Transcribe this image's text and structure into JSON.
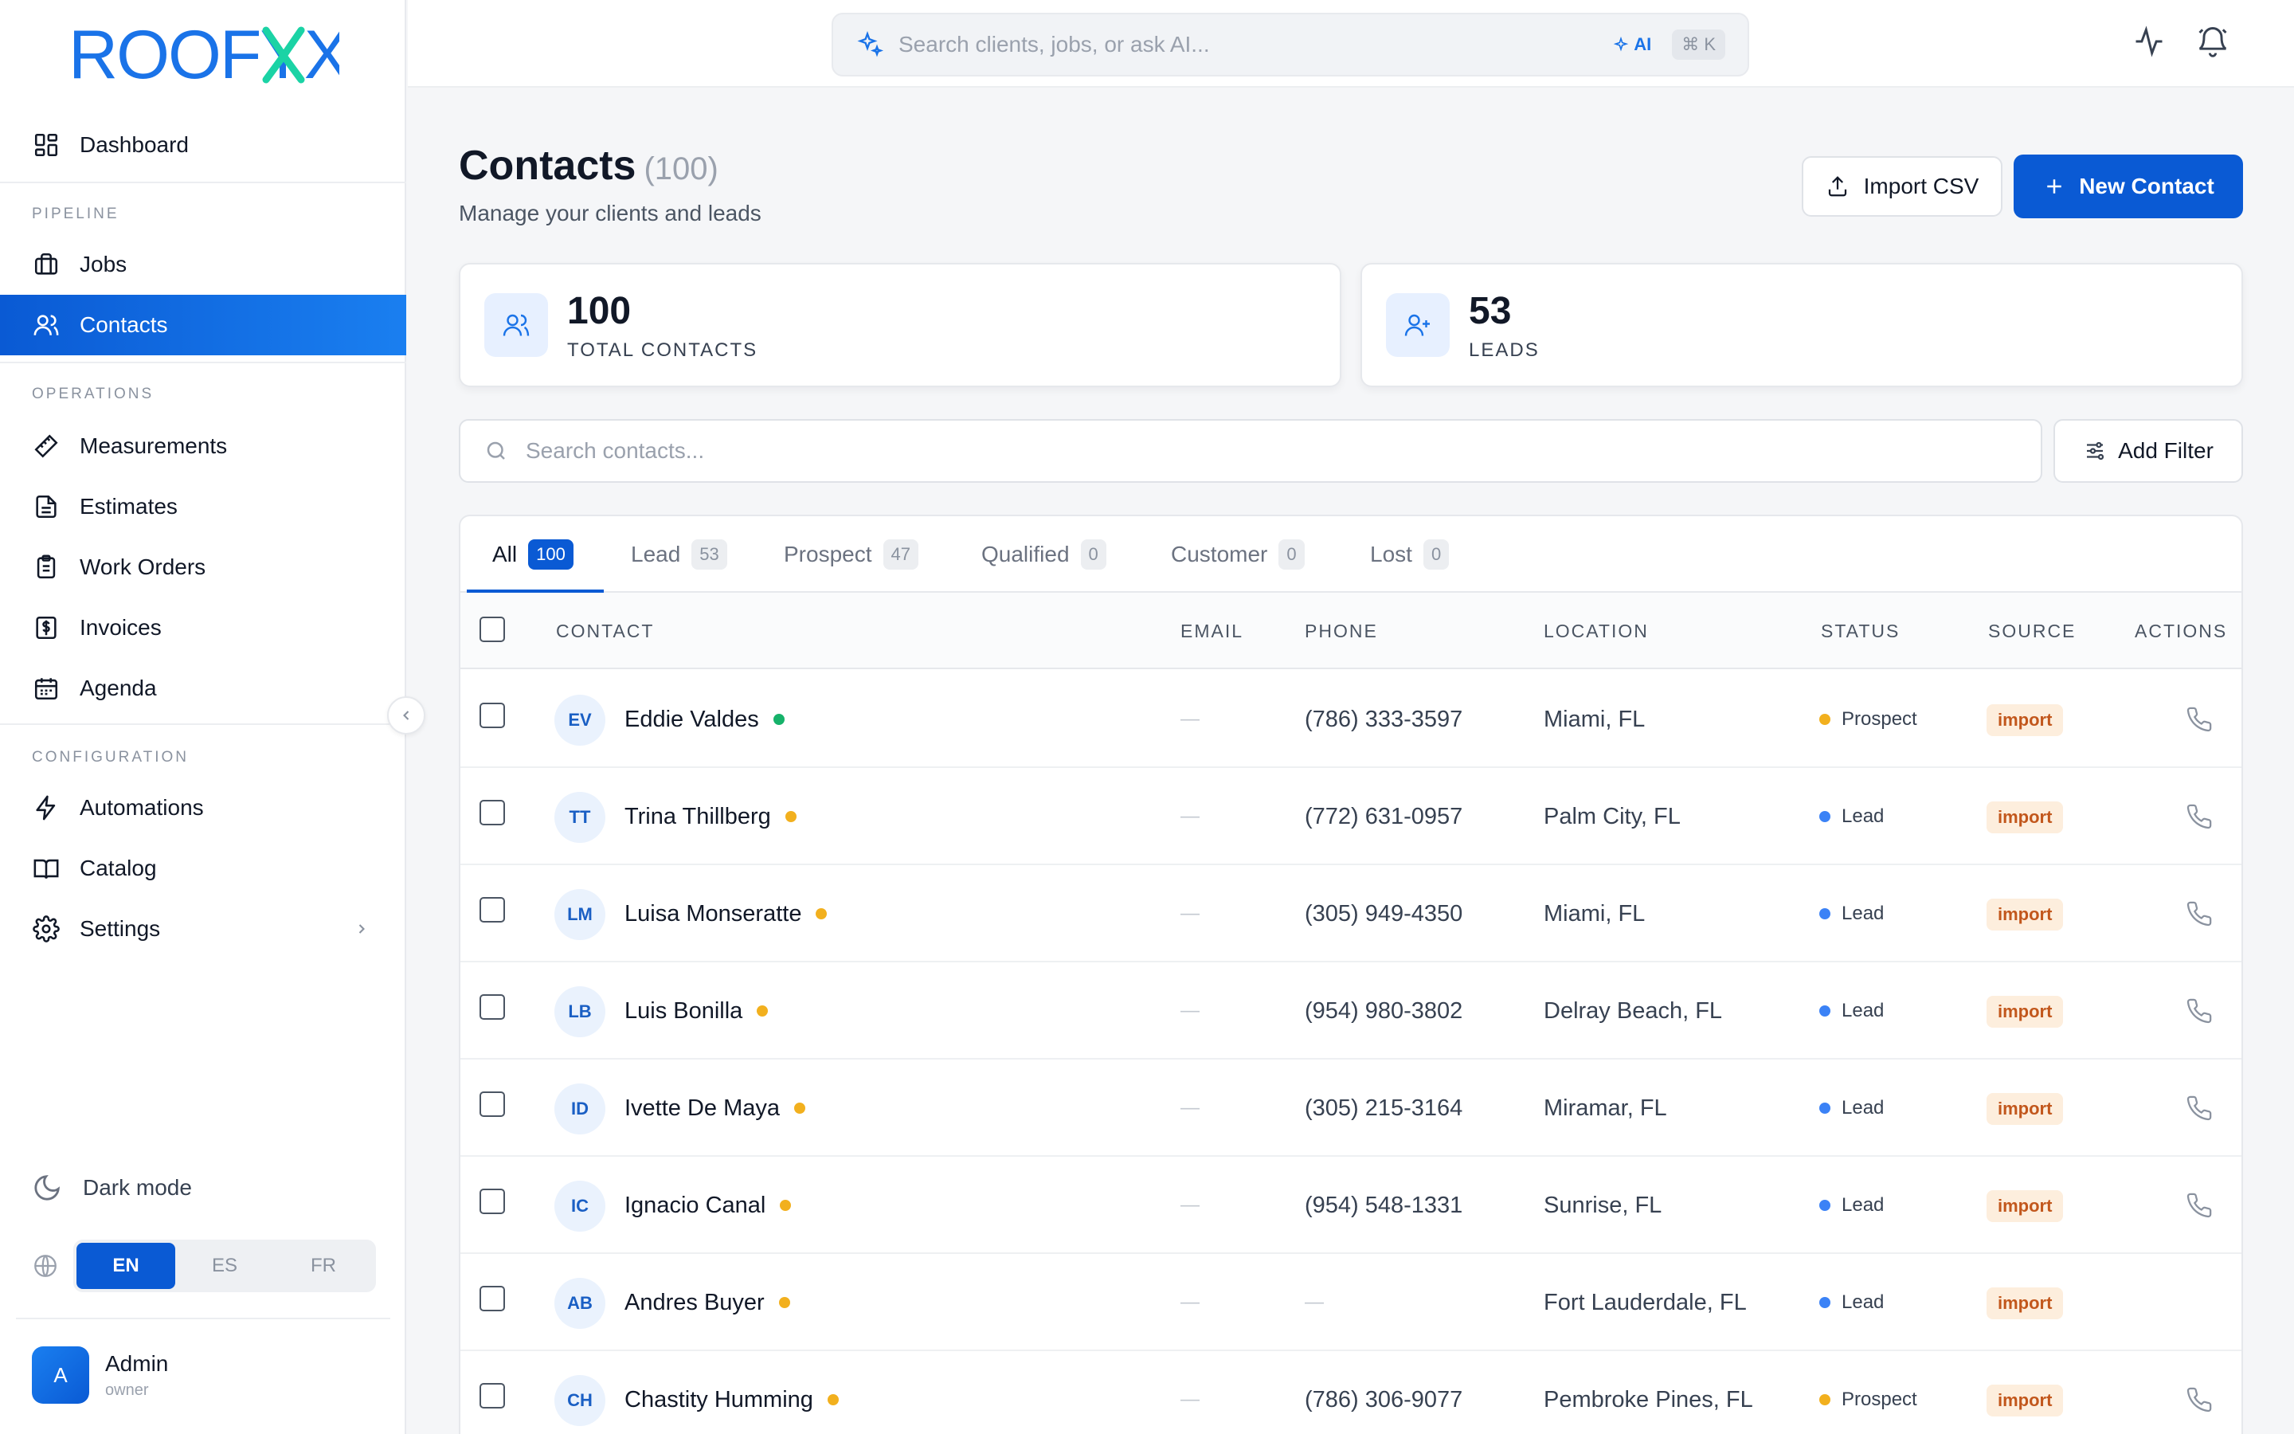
{
  "app": {
    "brand": "ROOFYX",
    "colors": {
      "accent": "#0a5ad4",
      "logo_blue": "#1a73e8",
      "logo_teal": "#1bd3a5",
      "import_bg": "#fdeedd",
      "import_fg": "#c2571c",
      "lead_dot": "#3b82f6",
      "prospect_dot": "#f2b01e",
      "active_dot": "#16b26a"
    }
  },
  "sidebar": {
    "dashboard": {
      "label": "Dashboard",
      "icon": "grid-icon"
    },
    "sections": {
      "pipeline": "PIPELINE",
      "operations": "OPERATIONS",
      "configuration": "CONFIGURATION"
    },
    "pipeline_items": [
      {
        "label": "Jobs",
        "icon": "briefcase-icon"
      },
      {
        "label": "Contacts",
        "icon": "users-icon",
        "active": true
      }
    ],
    "operations_items": [
      {
        "label": "Measurements",
        "icon": "ruler-icon"
      },
      {
        "label": "Estimates",
        "icon": "document-icon"
      },
      {
        "label": "Work Orders",
        "icon": "clipboard-icon"
      },
      {
        "label": "Invoices",
        "icon": "invoice-dollar-icon"
      },
      {
        "label": "Agenda",
        "icon": "calendar-icon"
      }
    ],
    "configuration_items": [
      {
        "label": "Automations",
        "icon": "lightning-icon"
      },
      {
        "label": "Catalog",
        "icon": "book-icon"
      },
      {
        "label": "Settings",
        "icon": "gear-icon"
      }
    ],
    "dark_mode": "Dark mode",
    "languages": [
      "EN",
      "ES",
      "FR"
    ],
    "selected_language": "EN",
    "user": {
      "initial": "A",
      "name": "Admin",
      "role": "owner"
    }
  },
  "topbar": {
    "search_placeholder": "Search clients, jobs, or ask AI...",
    "ai_label": "AI",
    "shortcut": "⌘ K"
  },
  "page": {
    "title": "Contacts",
    "count": "(100)",
    "subtitle": "Manage your clients and leads",
    "import_label": "Import CSV",
    "new_label": "New Contact"
  },
  "stats": [
    {
      "value": "100",
      "label": "TOTAL CONTACTS",
      "icon": "users-icon"
    },
    {
      "value": "53",
      "label": "LEADS",
      "icon": "user-plus-icon"
    }
  ],
  "filters": {
    "search_placeholder": "Search contacts...",
    "add_filter_label": "Add Filter"
  },
  "tabs": [
    {
      "label": "All",
      "count": "100",
      "active": true
    },
    {
      "label": "Lead",
      "count": "53"
    },
    {
      "label": "Prospect",
      "count": "47"
    },
    {
      "label": "Qualified",
      "count": "0"
    },
    {
      "label": "Customer",
      "count": "0"
    },
    {
      "label": "Lost",
      "count": "0"
    }
  ],
  "columns": [
    "CONTACT",
    "EMAIL",
    "PHONE",
    "LOCATION",
    "STATUS",
    "SOURCE",
    "ACTIONS"
  ],
  "rows": [
    {
      "initials": "EV",
      "name": "Eddie Valdes",
      "dot": "active",
      "email": "—",
      "phone": "(786) 333-3597",
      "location": "Miami, FL",
      "status": "Prospect",
      "source": "import",
      "call": true
    },
    {
      "initials": "TT",
      "name": "Trina Thillberg",
      "dot": "prospect",
      "email": "—",
      "phone": "(772) 631-0957",
      "location": "Palm City, FL",
      "status": "Lead",
      "source": "import",
      "call": true
    },
    {
      "initials": "LM",
      "name": "Luisa Monseratte",
      "dot": "prospect",
      "email": "—",
      "phone": "(305) 949-4350",
      "location": "Miami, FL",
      "status": "Lead",
      "source": "import",
      "call": true
    },
    {
      "initials": "LB",
      "name": "Luis Bonilla",
      "dot": "prospect",
      "email": "—",
      "phone": "(954) 980-3802",
      "location": "Delray Beach, FL",
      "status": "Lead",
      "source": "import",
      "call": true
    },
    {
      "initials": "ID",
      "name": "Ivette De Maya",
      "dot": "prospect",
      "email": "—",
      "phone": "(305) 215-3164",
      "location": "Miramar, FL",
      "status": "Lead",
      "source": "import",
      "call": true
    },
    {
      "initials": "IC",
      "name": "Ignacio Canal",
      "dot": "prospect",
      "email": "—",
      "phone": "(954) 548-1331",
      "location": "Sunrise, FL",
      "status": "Lead",
      "source": "import",
      "call": true
    },
    {
      "initials": "AB",
      "name": "Andres Buyer",
      "dot": "prospect",
      "email": "—",
      "phone": "—",
      "location": "Fort Lauderdale, FL",
      "status": "Lead",
      "source": "import",
      "call": false
    },
    {
      "initials": "CH",
      "name": "Chastity Humming",
      "dot": "prospect",
      "email": "—",
      "phone": "(786) 306-9077",
      "location": "Pembroke Pines, FL",
      "status": "Prospect",
      "source": "import",
      "call": true
    }
  ]
}
